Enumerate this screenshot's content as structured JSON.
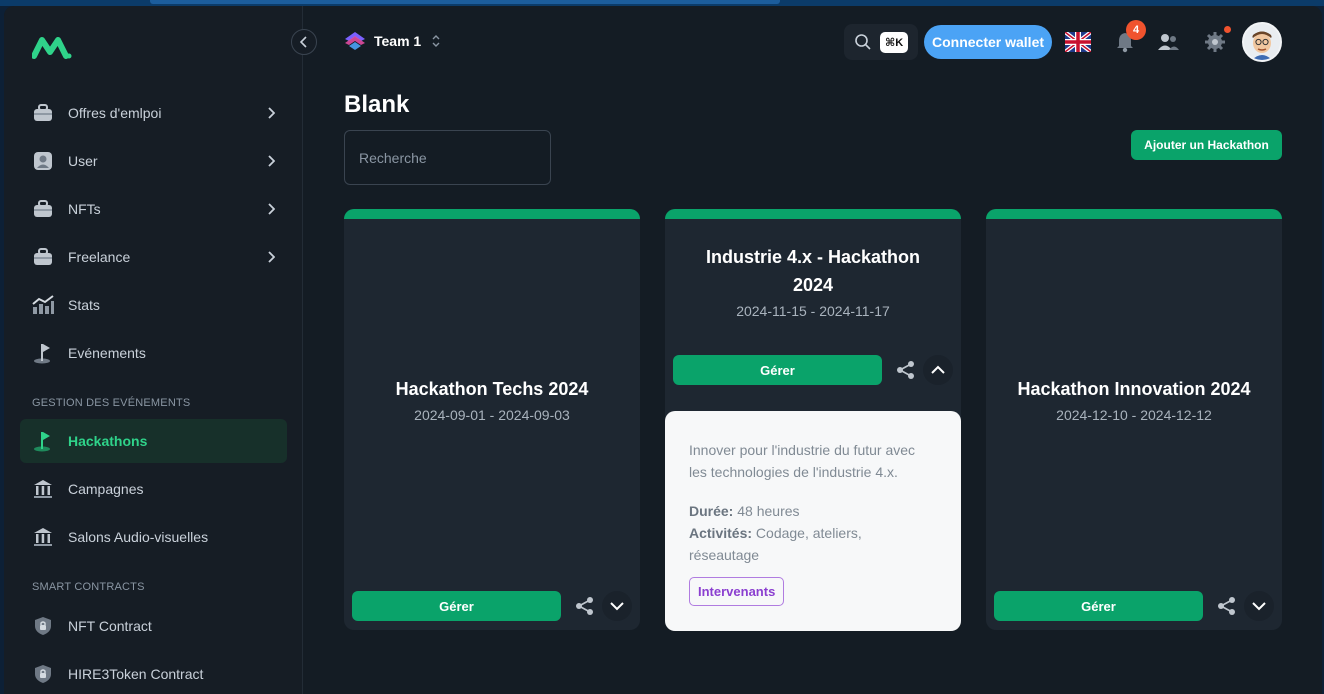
{
  "header": {
    "team_name": "Team 1",
    "search_shortcut": "⌘K",
    "wallet_button": "Connecter wallet",
    "notification_count": "4",
    "language": "en-GB"
  },
  "sidebar": {
    "items": [
      {
        "label": "Offres d'emlpoi",
        "icon": "briefcase-icon",
        "has_chevron": true
      },
      {
        "label": "User",
        "icon": "user-icon",
        "has_chevron": true
      },
      {
        "label": "NFTs",
        "icon": "briefcase-icon",
        "has_chevron": true
      },
      {
        "label": "Freelance",
        "icon": "briefcase-icon",
        "has_chevron": true
      },
      {
        "label": "Stats",
        "icon": "chart-icon",
        "has_chevron": false
      },
      {
        "label": "Evénements",
        "icon": "flag-icon",
        "has_chevron": false
      }
    ],
    "section_events": "GESTION DES EVÉNEMENTS",
    "events_items": [
      {
        "label": "Hackathons",
        "icon": "flag-icon",
        "active": true
      },
      {
        "label": "Campagnes",
        "icon": "bank-icon",
        "active": false
      },
      {
        "label": "Salons Audio-visuelles",
        "icon": "bank-icon",
        "active": false
      }
    ],
    "section_contracts": "SMART CONTRACTS",
    "contract_items": [
      {
        "label": "NFT Contract",
        "icon": "lock-icon"
      },
      {
        "label": "HIRE3Token Contract",
        "icon": "lock-icon"
      }
    ]
  },
  "main": {
    "title": "Blank",
    "search_placeholder": "Recherche",
    "add_button": "Ajouter un Hackathon",
    "cards": [
      {
        "title": "Hackathon Techs 2024",
        "dates": "2024-09-01 - 2024-09-03",
        "manage": "Gérer"
      },
      {
        "title_line1": "Industrie 4.x - Hackathon",
        "title_line2": "2024",
        "dates": "2024-11-15 - 2024-11-17",
        "manage": "Gérer",
        "description_line1": "Innover pour l'industrie du futur avec",
        "description_line2": "les technologies de l'industrie 4.x.",
        "duration_label": "Durée:",
        "duration_value": "48 heures",
        "activities_label": "Activités:",
        "activities_value": "Codage, ateliers,",
        "activities_value2": "réseautage",
        "tag": "Intervenants"
      },
      {
        "title": "Hackathon Innovation 2024",
        "dates": "2024-12-10 - 2024-12-12",
        "manage": "Gérer"
      }
    ]
  },
  "colors": {
    "accent_green": "#0aa36a",
    "wallet_blue": "#4ba3f5",
    "badge_red": "#f0532e",
    "tag_purple": "#8b3fd0"
  }
}
